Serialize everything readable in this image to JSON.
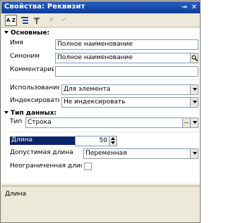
{
  "window": {
    "title": "Свойства: Реквизит",
    "pin_glyph": "⊸",
    "close_glyph": "✕"
  },
  "toolbar": {
    "sort_label": "A Z",
    "cancel_glyph": "✕",
    "ok_glyph": "✓",
    "icons": [
      "sort-alphabetical-icon",
      "categories-icon",
      "filter-icon",
      "cancel-icon",
      "ok-icon"
    ]
  },
  "sections": {
    "main": "Основные:",
    "types": "Тип данных:"
  },
  "props": {
    "name": {
      "label": "Имя",
      "value": "Полное наименование"
    },
    "synonym": {
      "label": "Синоним",
      "value": "Полное наименование"
    },
    "comment": {
      "label": "Комментарий",
      "value": ""
    },
    "usage": {
      "label": "Использование",
      "value": "Для элемента"
    },
    "indexing": {
      "label": "Индексировать",
      "value": "Не индексировать"
    },
    "type": {
      "label": "Тип",
      "value": "Строка"
    },
    "length": {
      "label": "Длина",
      "value": "50"
    },
    "allowed_length": {
      "label": "Допустимая длина",
      "value": "Переменная"
    },
    "unlimited": {
      "label": "Неограниченная длина",
      "checked": false
    }
  },
  "description": {
    "text": "Длина"
  },
  "colors": {
    "selection": "#0a246a",
    "titlebar": "#0a3c9c",
    "panel_bg": "#ece9d8"
  }
}
